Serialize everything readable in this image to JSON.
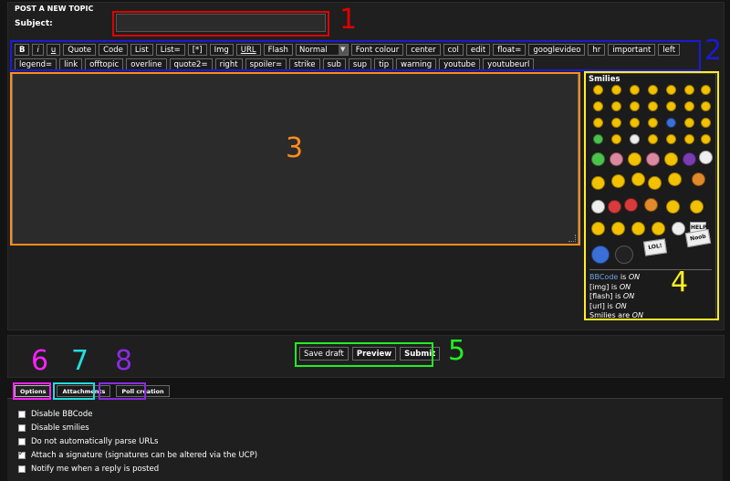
{
  "header": {
    "title": "POST A NEW TOPIC",
    "subject_label": "Subject:",
    "subject_value": ""
  },
  "toolbar": {
    "buttons": [
      "B",
      "i",
      "u",
      "Quote",
      "Code",
      "List",
      "List=",
      "[*]",
      "Img",
      "URL",
      "Flash"
    ],
    "font_size_select": "Normal",
    "buttons2": [
      "Font colour",
      "center",
      "col",
      "edit",
      "float=",
      "googlevideo",
      "hr",
      "important",
      "left",
      "legend=",
      "link",
      "offtopic",
      "overline",
      "quote2=",
      "right",
      "spoiler=",
      "strike",
      "sub",
      "sup",
      "tip",
      "warning",
      "youtube",
      "youtubeurl"
    ]
  },
  "smilies": {
    "title": "Smilies",
    "sign_lol": "LOL!",
    "sign_noob": "Noob",
    "sign_help": "HELP",
    "status": {
      "bbcode_link": "BBCode",
      "bbcode_is": " is ",
      "bbcode_state": "ON",
      "img_label": "[img] is ",
      "img_state": "ON",
      "flash_label": "[flash] is ",
      "flash_state": "ON",
      "url_label": "[url] is ",
      "url_state": "ON",
      "smilies_label": "Smilies are ",
      "smilies_state": "ON"
    }
  },
  "actions": {
    "save_draft": "Save draft",
    "preview": "Preview",
    "submit": "Submit"
  },
  "tabs": {
    "options": "Options",
    "attachments": "Attachments",
    "poll": "Poll creation"
  },
  "options": [
    {
      "label": "Disable BBCode",
      "checked": false
    },
    {
      "label": "Disable smilies",
      "checked": false
    },
    {
      "label": "Do not automatically parse URLs",
      "checked": false
    },
    {
      "label": "Attach a signature (signatures can be altered via the UCP)",
      "checked": true
    },
    {
      "label": "Notify me when a reply is posted",
      "checked": false
    }
  ],
  "annotations": {
    "colors": {
      "red": "#e00000",
      "blue": "#1a1ad6",
      "orange": "#ff8c1a",
      "yellow": "#ffee22",
      "green": "#22ee22",
      "magenta": "#ff22ff",
      "cyan": "#22dddd",
      "purple": "#8a2be2"
    },
    "labels": [
      "1",
      "2",
      "3",
      "4",
      "5",
      "6",
      "7",
      "8"
    ]
  }
}
